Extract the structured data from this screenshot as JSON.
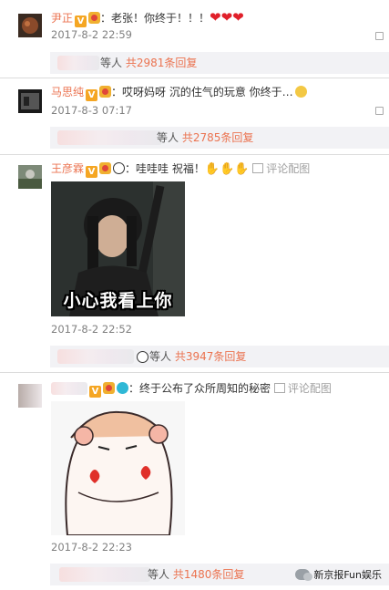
{
  "comments": [
    {
      "username": "尹正",
      "text": "：老张！你终于！！！",
      "date": "2017-8-2 22:59",
      "reply": {
        "suffix": "等人 ",
        "count": "共2981条回复"
      }
    },
    {
      "username": "马思纯",
      "text": "：哎呀妈呀 沉的住气的玩意 你终于…",
      "date": "2017-8-3 07:17",
      "reply": {
        "suffix": "等人 ",
        "count": "共2785条回复"
      }
    },
    {
      "username": "王彦霖",
      "text": "：哇哇哇 祝福！",
      "image_action": "评论配图",
      "image_caption": "小心我看上你",
      "date": "2017-8-2 22:52",
      "reply": {
        "suffix": "等人 ",
        "count": "共3947条回复"
      }
    },
    {
      "username": "",
      "text": "：终于公布了众所周知的秘密",
      "image_action": "评论配图",
      "date": "2017-8-2 22:23",
      "reply": {
        "suffix": "等人 ",
        "count": "共1480条回复"
      }
    }
  ],
  "watermark": "新京报Fun娱乐",
  "colors": {
    "username": "#eb7350",
    "reply_bg": "#f2f2f5",
    "heart": "#e0202a"
  }
}
